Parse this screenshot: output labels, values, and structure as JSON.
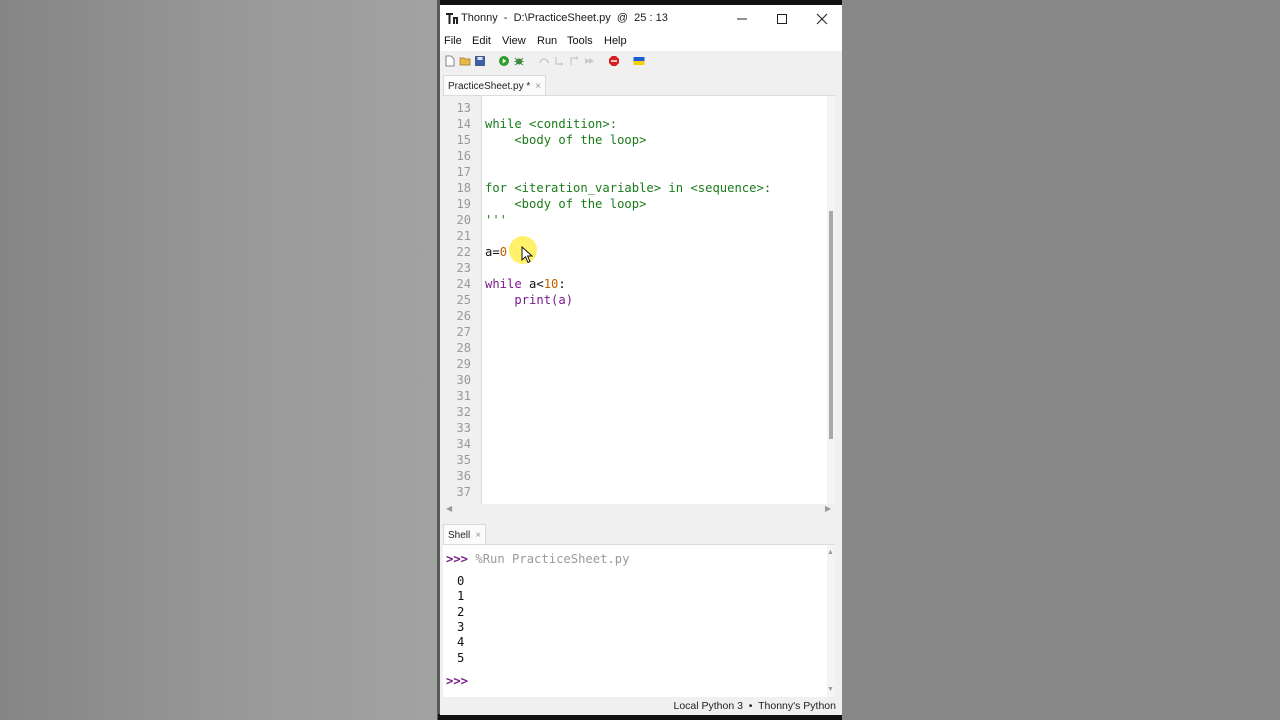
{
  "window": {
    "title": "Thonny  -  D:\\PracticeSheet.py  @  25 : 13"
  },
  "menu": [
    "File",
    "Edit",
    "View",
    "Run",
    "Tools",
    "Help"
  ],
  "toolbar": {
    "icons": [
      "new-file-icon",
      "open-folder-icon",
      "save-icon",
      "run-icon",
      "debug-icon",
      "step-over-icon",
      "step-into-icon",
      "step-out-icon",
      "resume-icon",
      "stop-icon",
      "ukraine-flag-icon"
    ],
    "colors": {
      "run": "#2a9d2a",
      "stop": "#d42020"
    }
  },
  "editor": {
    "tab_label": "PracticeSheet.py *",
    "tab_close": "×",
    "line_numbers": [
      "13",
      "14",
      "15",
      "16",
      "17",
      "18",
      "19",
      "20",
      "21",
      "22",
      "23",
      "24",
      "25",
      "26",
      "27",
      "28",
      "29",
      "30",
      "31",
      "32",
      "33",
      "34",
      "35",
      "36",
      "37"
    ],
    "lines": {
      "l14": "while <condition>:",
      "l15": "    <body of the loop>",
      "l18": "for <iteration_variable> in <sequence>:",
      "l19": "    <body of the loop>",
      "l20": "'''",
      "l22_var": "a=",
      "l22_num": "0",
      "l24_kw": "while",
      "l24_var": " a<",
      "l24_num": "10",
      "l24_end": ":",
      "l25_indent": "    ",
      "l25_fn": "print(a)"
    }
  },
  "shell": {
    "tab_label": "Shell",
    "tab_close": "×",
    "prompt": ">>>",
    "run_command": " %Run PracticeSheet.py",
    "output": [
      "0",
      "1",
      "2",
      "3",
      "4",
      "5"
    ],
    "end_prompt": ">>>"
  },
  "statusbar": {
    "text": "Local Python 3  •  Thonny's Python"
  }
}
